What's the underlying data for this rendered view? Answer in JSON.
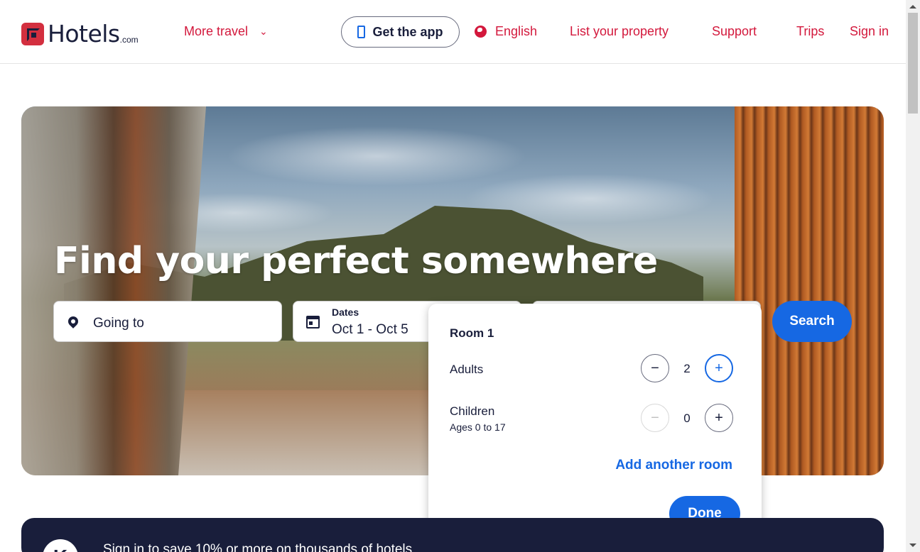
{
  "header": {
    "logo_text": "Hotels",
    "logo_sub": ".com",
    "more_travel": "More travel",
    "get_app": "Get the app",
    "language": "English",
    "list_property": "List your property",
    "support": "Support",
    "trips": "Trips",
    "sign_in": "Sign in"
  },
  "hero": {
    "title": "Find your perfect somewhere",
    "going_to_placeholder": "Going to",
    "dates_label": "Dates",
    "dates_value": "Oct 1 - Oct 5",
    "search_label": "Search"
  },
  "travelers_popup": {
    "room_title": "Room 1",
    "adults_label": "Adults",
    "adults_value": "2",
    "children_label": "Children",
    "children_sublabel": "Ages 0 to 17",
    "children_value": "0",
    "minus_symbol": "−",
    "plus_symbol": "+",
    "add_room": "Add another room",
    "done": "Done"
  },
  "banner": {
    "avatar_letter": "K",
    "text": "Sign in to save 10% or more on thousands of hotels"
  },
  "colors": {
    "brand_red": "#d3183c",
    "primary_blue": "#1668e3",
    "navy": "#191e3b"
  }
}
